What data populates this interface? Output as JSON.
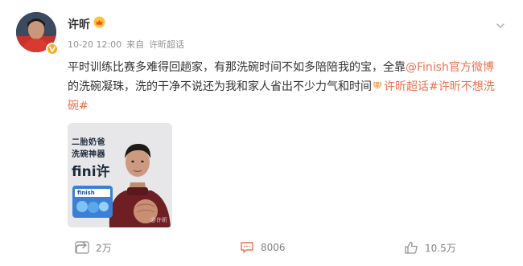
{
  "post": {
    "author": {
      "name": "许昕",
      "avatar_icon": "avatar-photo",
      "verified_icon": "verified-v-icon",
      "member_icon": "crown-icon"
    },
    "meta": {
      "time": "10-20 12:00",
      "source_prefix": "来自",
      "source": "许昕超话"
    },
    "text": {
      "part1": "平时训练比赛多难得回趟家，有那洗碗时间不如多陪陪我的宝，全靠",
      "mention": "@Finish官方微博",
      "part2": "的洗碗凝珠，洗的干净不说还为我和家人省出不少力气和时间",
      "topic_icon": "diamond-icon",
      "topic1": "许昕超话",
      "hashtag": "#许昕不想洗碗#"
    },
    "image": {
      "overlay_line1": "二胎奶爸",
      "overlay_line2": "洗碗神器",
      "overlay_line3": "fini许",
      "product_label": "finish",
      "watermark": "@许昕"
    },
    "actions": {
      "forward": "2万",
      "comment": "8006",
      "like": "10.5万"
    },
    "colors": {
      "link": "#eb7350",
      "verified": "#f7a928",
      "meta": "#939393",
      "action_text": "#808080"
    }
  }
}
